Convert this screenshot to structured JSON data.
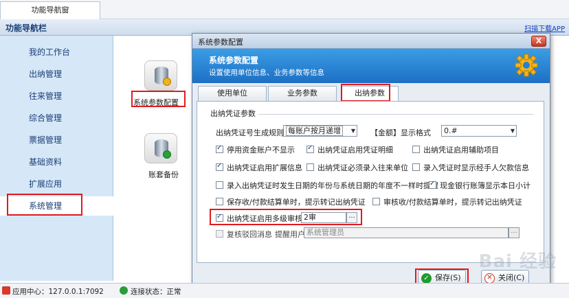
{
  "window": {
    "tab_label": "功能导航窗"
  },
  "navbar": {
    "title": "功能导航栏",
    "download_link": "扫描下载APP"
  },
  "sidebar": {
    "items": [
      {
        "label": "我的工作台"
      },
      {
        "label": "出纳管理"
      },
      {
        "label": "往来管理"
      },
      {
        "label": "综合管理"
      },
      {
        "label": "票据管理"
      },
      {
        "label": "基础资料"
      },
      {
        "label": "扩展应用"
      },
      {
        "label": "系统管理"
      }
    ],
    "selected": "系统管理"
  },
  "main": {
    "icons": [
      {
        "label": "系统参数配置",
        "icon": "database-gear-icon"
      },
      {
        "label": "账套备份",
        "icon": "database-backup-icon"
      }
    ]
  },
  "dialog": {
    "title": "系统参数配置",
    "close": "X",
    "banner_title": "系统参数配置",
    "banner_desc": "设置使用单位信息、业务参数等信息",
    "tabs": [
      {
        "label": "使用单位"
      },
      {
        "label": "业务参数"
      },
      {
        "label": "出纳参数"
      }
    ],
    "active_tab": "出纳参数",
    "group_title": "出纳凭证参数",
    "voucher_rule_label": "出纳凭证号生成规则",
    "voucher_rule_value": "每账户按月递增",
    "amount_format_label": "【金额】显示格式",
    "amount_format_value": "0.#",
    "options": [
      {
        "label": "停用资金账户不显示",
        "checked": true
      },
      {
        "label": "出纳凭证启用凭证明细",
        "checked": true
      },
      {
        "label": "出纳凭证启用辅助项目",
        "checked": false
      },
      {
        "label": "出纳凭证启用扩展信息",
        "checked": true
      },
      {
        "label": "出纳凭证必须录入往来单位",
        "checked": false
      },
      {
        "label": "录入凭证时显示经手人欠款信息",
        "checked": false
      },
      {
        "label": "录入出纳凭证时发生日期的年份与系统日期的年度不一样时提醒",
        "checked": false
      },
      {
        "label": "现金银行账簿显示本日小计",
        "checked": true
      },
      {
        "label": "保存收/付款结算单时，提示转记出纳凭证",
        "checked": false
      },
      {
        "label": "审核收/付款结算单时，提示转记出纳凭证",
        "checked": false
      }
    ],
    "multi_review": {
      "label": "出纳凭证启用多级审核",
      "checked": true,
      "value": "2审",
      "button": "..."
    },
    "return_msg": {
      "label": "复核驳回消息",
      "checked": false,
      "remind_label": "提醒用户",
      "remind_value": "系统管理员",
      "button": "..."
    },
    "save_button": "保存(S)",
    "close_button": "关闭(C)"
  },
  "statusbar": {
    "app_center": "应用中心：127.0.0.1:7092",
    "connection": "连接状态：正常"
  },
  "watermark": "Bai 经验",
  "colors": {
    "highlight": "#e0191e",
    "banner": "#2680d4",
    "sidebar": "#d6e7f7"
  }
}
